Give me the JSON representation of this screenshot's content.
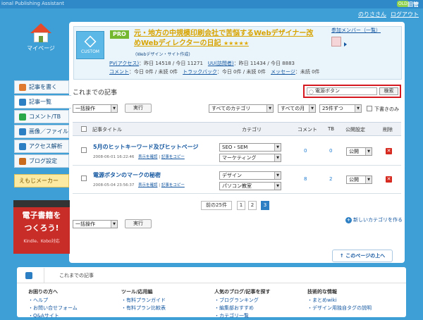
{
  "app": {
    "title": "ional Publishing Assistant",
    "old_badge": "OLD",
    "old_label": "旧管"
  },
  "user": {
    "name": "のりささん",
    "logout": "ログアウト"
  },
  "mypage": {
    "label": "マイページ"
  },
  "sidebar": {
    "items": [
      {
        "label": "記事を書く",
        "color": "#e07a2e"
      },
      {
        "label": "記事一覧",
        "color": "#2d7fc4"
      },
      {
        "label": "コメント/TB",
        "color": "#2aa84a"
      },
      {
        "label": "画像／ファイル",
        "color": "#2d7fc4"
      },
      {
        "label": "アクセス解析",
        "color": "#2d7fc4"
      },
      {
        "label": "ブログ設定",
        "color": "#c96a1d"
      }
    ],
    "emoji": "えもじメーカー"
  },
  "ad": {
    "line1": "電子書籍を",
    "line2": "つくろう!",
    "line3": "Kindle、Kobo対応"
  },
  "profile": {
    "custom_label": "CUSTOM",
    "pro": "PRO",
    "title": "元・地方の中規模印刷会社で苦悩するWebデザイナー改めWebディレクターの日記",
    "stars": "★★★★★",
    "sub": "(Webデザイン・サイト作成)",
    "stats_line1": [
      {
        "k": "PV(アクセス)",
        "v": "：昨日 14518 / 今日 11271"
      },
      {
        "k": "UU(訪問者)",
        "v": "：昨日 11434 / 今日 8883"
      }
    ],
    "stats_line2": [
      {
        "k": "コメント",
        "v": "：今日 0件 / 未読 0件"
      },
      {
        "k": "トラックバック",
        "v": "：今日 0件 / 未読 0件"
      },
      {
        "k": "メッセージ",
        "v": "：未読 0件"
      }
    ]
  },
  "members": {
    "label": "参加メンバー（一覧）"
  },
  "section": {
    "title": "これまでの記事"
  },
  "search": {
    "value": "電源ボタン",
    "button": "検索"
  },
  "controls": {
    "bulk": "一括操作",
    "exec": "実行",
    "category": "すべてのカテゴリ",
    "month": "すべての月",
    "per_page": "25件ずつ",
    "draft_only": "下書きのみ"
  },
  "table": {
    "headers": [
      "記事タイトル",
      "カテゴリ",
      "コメント",
      "TB",
      "公開設定",
      "削除"
    ],
    "rows": [
      {
        "title": "5月のヒットキーワード及びヒットページ",
        "date": "2008-06-01 16:22:46",
        "preview": "表示を確認",
        "copy": "記事をコピー",
        "cat1": "SEO・SEM",
        "cat2": "マーケティング",
        "comments": "0",
        "tb": "0",
        "status": "公開"
      },
      {
        "title": "電源ボタンのマークの秘密",
        "date": "2008-05-04 23:56:37",
        "preview": "表示を確認",
        "copy": "記事をコピー",
        "cat1": "デザイン",
        "cat2": "パソコン教室",
        "comments": "8",
        "tb": "2",
        "status": "公開"
      }
    ]
  },
  "pager": {
    "prev": "前の25件",
    "pages": [
      "1",
      "2",
      "3"
    ]
  },
  "newcat": "新しいカテゴリを作る",
  "totop": "このページの上へ",
  "breadcrumb": "これまでの記事",
  "footer": [
    {
      "h": "お困りの方へ",
      "items": [
        "ヘルプ",
        "お問い合せフォーム",
        "Q&Aサイト"
      ]
    },
    {
      "h": "ツール/応用編",
      "items": [
        "有料プランガイド",
        "有料プラン比較表"
      ]
    },
    {
      "h": "人気のブログ/記事を探す",
      "items": [
        "ブログランキング",
        "編集部おすすめ",
        "カテゴリ一覧"
      ]
    },
    {
      "h": "技術的な情報",
      "items": [
        "まとめwiki",
        "デザイン用独自タグの説明"
      ]
    }
  ]
}
